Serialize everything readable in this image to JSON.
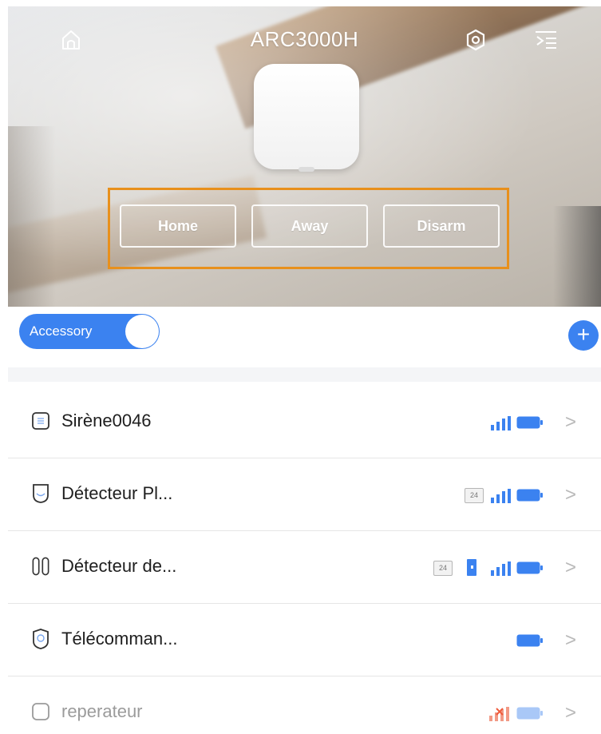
{
  "header": {
    "title": "ARC3000H",
    "icons": [
      "home-icon",
      "settings-icon",
      "menu-icon"
    ]
  },
  "modes": {
    "home_label": "Home",
    "away_label": "Away",
    "disarm_label": "Disarm",
    "highlight_color": "#e8901c"
  },
  "accessory_bar": {
    "toggle_label": "Accessory",
    "toggle_on": true,
    "add_icon": "plus-icon",
    "accent_color": "#3b82f0"
  },
  "devices": [
    {
      "name": "Sirène0046",
      "icon": "siren-icon",
      "badge_24": false,
      "door_sensor": false,
      "signal": "blue-full",
      "battery": "blue"
    },
    {
      "name": "Détecteur Pl...",
      "icon": "pir-detector-icon",
      "badge_24": true,
      "badge_label": "24",
      "door_sensor": false,
      "signal": "blue-full",
      "battery": "blue"
    },
    {
      "name": "Détecteur de...",
      "icon": "door-contact-icon",
      "badge_24": true,
      "badge_label": "24",
      "door_sensor": true,
      "signal": "blue-full",
      "battery": "blue"
    },
    {
      "name": "Télécomman...",
      "icon": "remote-control-icon",
      "badge_24": false,
      "door_sensor": false,
      "signal": "none",
      "battery": "blue"
    },
    {
      "name": "reperateur",
      "icon": "repeater-icon",
      "badge_24": false,
      "door_sensor": false,
      "signal": "red-offline",
      "battery": "light-blue",
      "dimmed": true
    }
  ]
}
